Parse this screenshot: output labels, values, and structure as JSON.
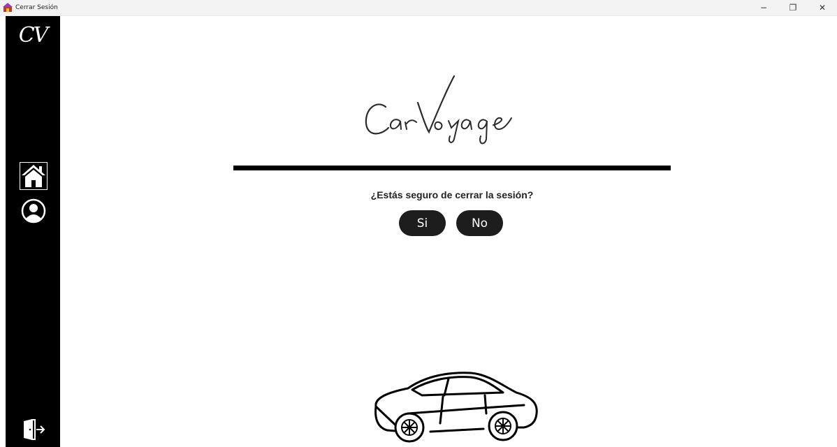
{
  "window": {
    "title": "Cerrar Sesión",
    "controls": {
      "minimize": "−",
      "restore": "❐",
      "close": "✕"
    }
  },
  "sidebar": {
    "logo": "CV",
    "items": [
      {
        "name": "home",
        "icon": "home-icon"
      },
      {
        "name": "profile",
        "icon": "user-circle-icon"
      },
      {
        "name": "logout",
        "icon": "door-exit-icon"
      }
    ]
  },
  "main": {
    "brand": "CarVoyage",
    "question": "¿Estás seguro de cerrar la sesión?",
    "buttons": {
      "yes": "Si",
      "no": "No"
    },
    "illustration": "car-icon"
  },
  "colors": {
    "sidebar": "#000000",
    "button": "#1d1d1d",
    "background": "#ffffff"
  }
}
